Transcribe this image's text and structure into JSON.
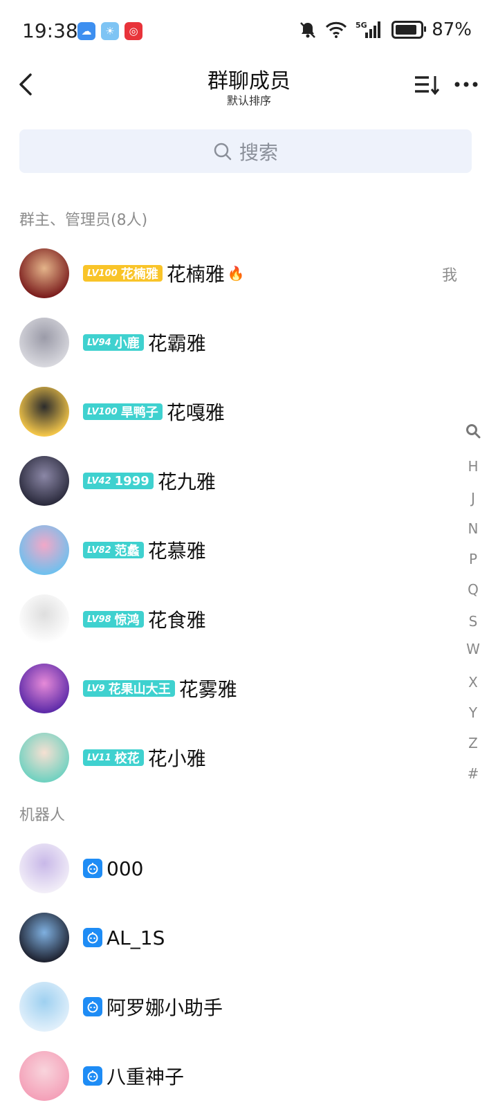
{
  "status_bar": {
    "time": "19:38",
    "battery": "87%",
    "network": "5G",
    "battery_level": 0.87
  },
  "header": {
    "title": "群聊成员",
    "subtitle": "默认排序"
  },
  "search": {
    "placeholder": "搜索"
  },
  "sections": {
    "admins_title": "群主、管理员(8人)",
    "bots_title": "机器人"
  },
  "members": [
    {
      "level": "LV100",
      "tag": "花楠雅",
      "tag_color": "#f9c429",
      "name": "花楠雅",
      "is_me_label": "我",
      "avatar_colors": [
        "#7a1c1c",
        "#e4b48a"
      ]
    },
    {
      "level": "LV94",
      "tag": "小鹿",
      "tag_color": "#3fd1cf",
      "name": "花霸雅",
      "avatar_colors": [
        "#d8d8de",
        "#9b9ba8"
      ]
    },
    {
      "level": "LV100",
      "tag": "旱鸭子",
      "tag_color": "#3fd1cf",
      "name": "花嘎雅",
      "avatar_colors": [
        "#f6c84a",
        "#2c2c2c"
      ]
    },
    {
      "level": "LV42",
      "tag": "1999",
      "tag_color": "#3fd1cf",
      "name": "花九雅",
      "avatar_colors": [
        "#2a2a3c",
        "#8b87a6"
      ]
    },
    {
      "level": "LV82",
      "tag": "范蠡",
      "tag_color": "#3fd1cf",
      "name": "花慕雅",
      "avatar_colors": [
        "#6ec0ee",
        "#f2a8c8"
      ]
    },
    {
      "level": "LV98",
      "tag": "惊鸿",
      "tag_color": "#3fd1cf",
      "name": "花食雅",
      "avatar_colors": [
        "#ffffff",
        "#dedede"
      ]
    },
    {
      "level": "LV9",
      "tag": "花果山大王",
      "tag_color": "#3fd1cf",
      "name": "花雾雅",
      "avatar_colors": [
        "#5c2aa8",
        "#e68ad8"
      ]
    },
    {
      "level": "LV11",
      "tag": "校花",
      "tag_color": "#3fd1cf",
      "name": "花小雅",
      "avatar_colors": [
        "#6fd1c0",
        "#f6e0d2"
      ]
    }
  ],
  "bots": [
    {
      "name": "000",
      "avatar_colors": [
        "#f2eef8",
        "#c8b8e8"
      ]
    },
    {
      "name": "AL_1S",
      "avatar_colors": [
        "#1e2230",
        "#7fb0e0"
      ]
    },
    {
      "name": "阿罗娜小助手",
      "avatar_colors": [
        "#e2f0fb",
        "#9ed0f0"
      ]
    },
    {
      "name": "八重神子",
      "avatar_colors": [
        "#f4a0b8",
        "#f8d4dc"
      ]
    }
  ],
  "index_letters": [
    "H",
    "J",
    "N",
    "P",
    "Q",
    "S",
    "W",
    "X",
    "Y",
    "Z",
    "#"
  ]
}
